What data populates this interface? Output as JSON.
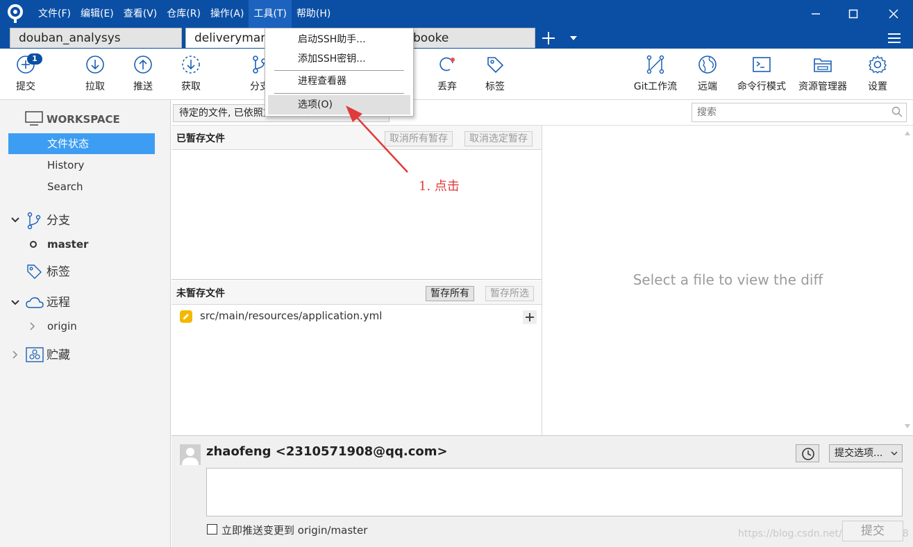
{
  "menubar": {
    "menus": [
      "文件(F)",
      "编辑(E)",
      "查看(V)",
      "仓库(R)",
      "操作(A)",
      "工具(T)",
      "帮助(H)"
    ],
    "active_menu": "工具(T)"
  },
  "tabs": {
    "items": [
      "douban_analysys",
      "deliveryman",
      "booke"
    ]
  },
  "toolbar": {
    "commit": "提交",
    "commit_badge": "1",
    "pull": "拉取",
    "push": "推送",
    "fetch": "获取",
    "branch": "分支",
    "discard": "丢弃",
    "tag": "标签",
    "gitflow": "Git工作流",
    "remote": "远端",
    "terminal": "命令行模式",
    "explorer": "资源管理器",
    "settings": "设置"
  },
  "tools_menu": {
    "items": [
      "启动SSH助手...",
      "添加SSH密钥...",
      "进程查看器",
      "选项(O)"
    ],
    "highlighted": "选项(O)"
  },
  "sidebar": {
    "workspace": "WORKSPACE",
    "workspace_items": [
      "文件状态",
      "History",
      "Search"
    ],
    "branches_label": "分支",
    "current_branch": "master",
    "tags_label": "标签",
    "remotes_label": "远程",
    "remote_origin": "origin",
    "stash_label": "贮藏"
  },
  "filter": {
    "value": "待定的文件, 已依照文件状态排序",
    "search_placeholder": "搜索"
  },
  "staged": {
    "title": "已暂存文件",
    "unstage_all": "取消所有暂存",
    "unstage_selected": "取消选定暂存"
  },
  "unstaged": {
    "title": "未暂存文件",
    "stage_all": "暂存所有",
    "stage_selected": "暂存所选",
    "files": [
      "src/main/resources/application.yml"
    ]
  },
  "diff": {
    "placeholder": "Select a file to view the diff"
  },
  "commit": {
    "author": "zhaofeng <2310571908@qq.com>",
    "options_label": "提交选项...",
    "push_label": "立即推送变更到 origin/master",
    "commit_button": "提交"
  },
  "annotation": {
    "text": "1.  点击",
    "color": "#e03a3a"
  },
  "watermark": "https://blog.csdn.net/qq_43159908",
  "colors": {
    "titlebar": "#0b4fa5",
    "selection": "#3c9df2",
    "icon_blue": "#1a5fb4"
  }
}
